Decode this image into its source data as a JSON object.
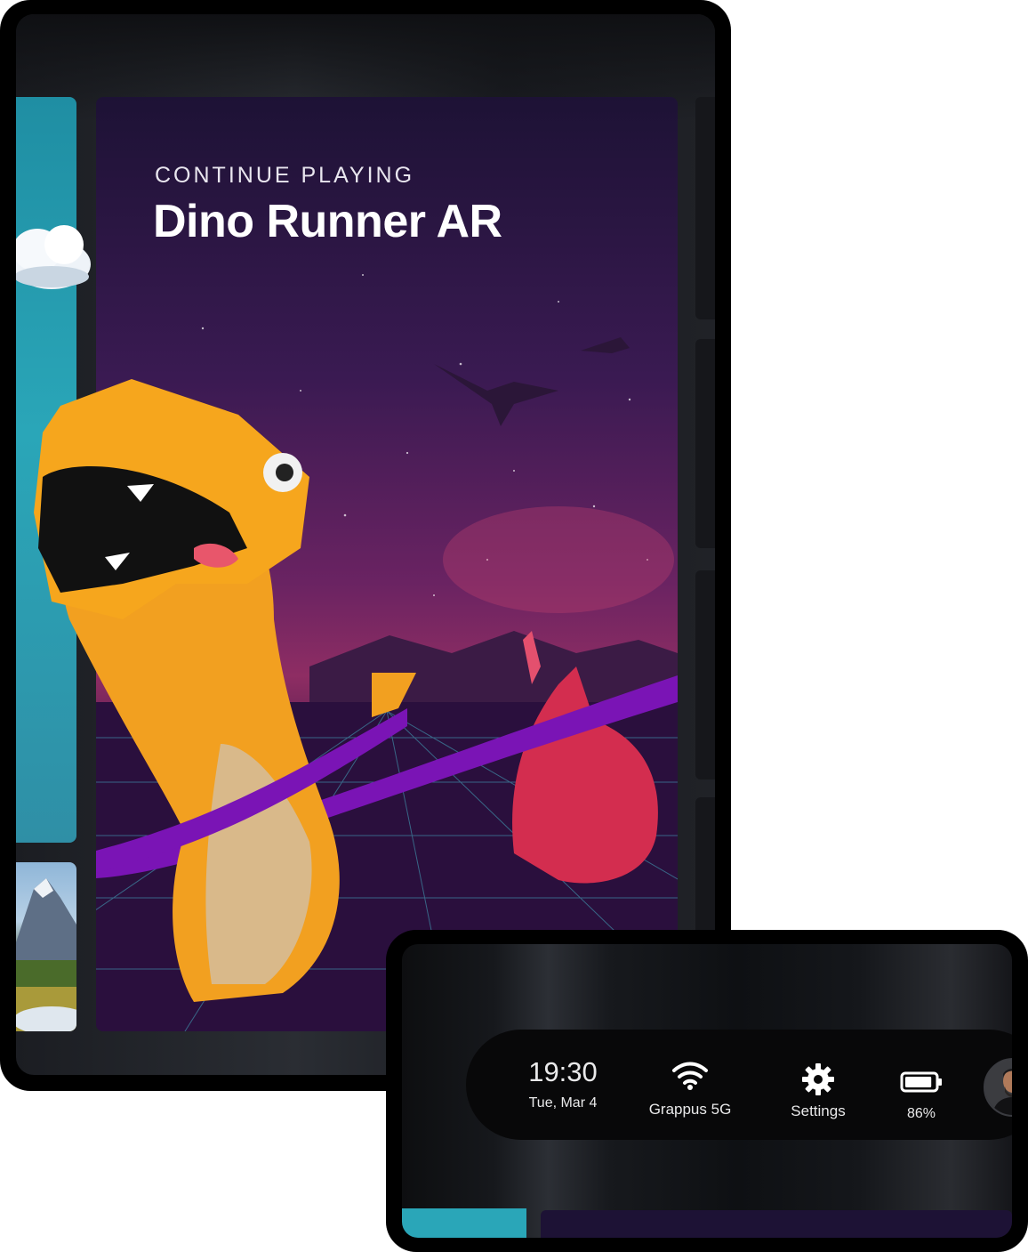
{
  "hero": {
    "eyebrow": "CONTINUE PLAYING",
    "title": "Dino Runner AR"
  },
  "status_bar": {
    "time": "19:30",
    "date": "Tue, Mar 4",
    "wifi_label": "Grappus 5G",
    "settings_label": "Settings",
    "battery_label": "86%",
    "battery_level": 0.86,
    "icons": [
      "wifi-icon",
      "gear-icon",
      "battery-icon",
      "avatar"
    ]
  },
  "colors": {
    "teal": "#2aa6b8",
    "hero_purple": "#3a1a52",
    "hero_magenta": "#8e2d63",
    "dino_orange": "#f3a11e",
    "ribbon_purple": "#7a14b5"
  }
}
